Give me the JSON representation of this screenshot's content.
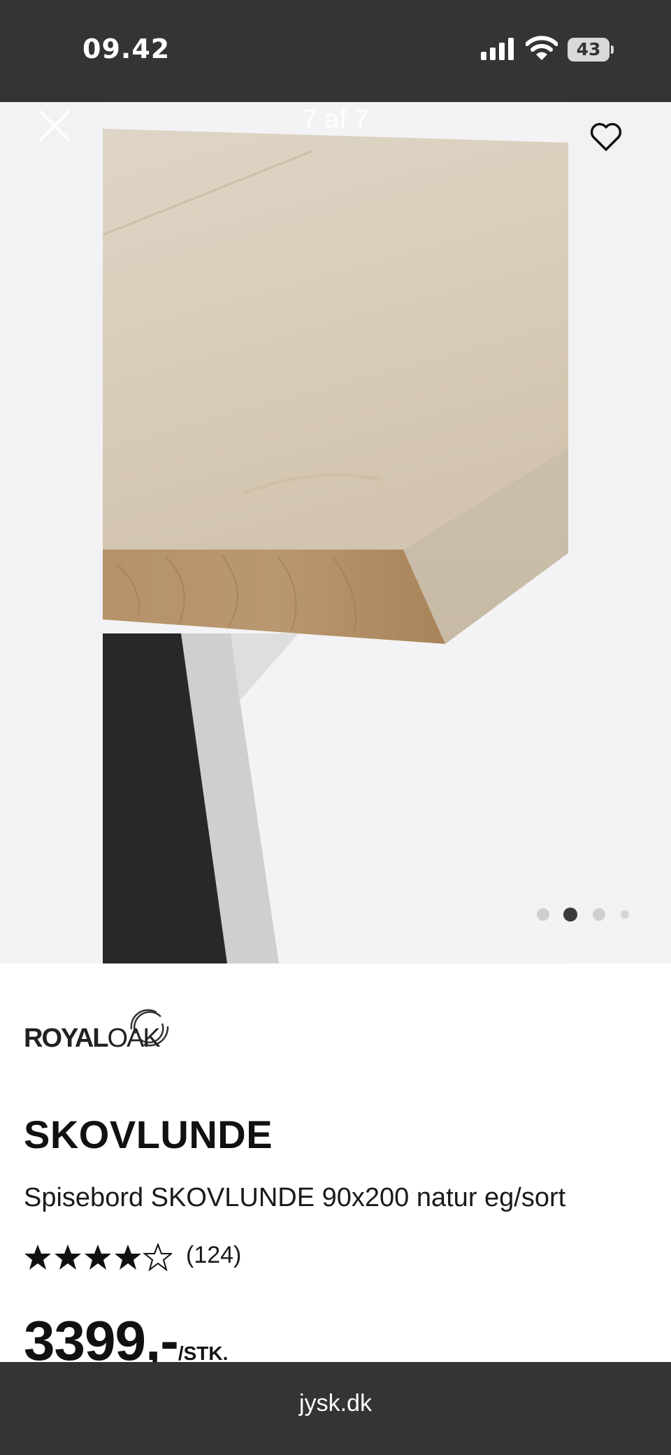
{
  "status_bar": {
    "time": "09.42",
    "battery_percent": "43",
    "icons": [
      "cellular-signal-icon",
      "wifi-icon",
      "battery-icon"
    ]
  },
  "gallery": {
    "counter": "7 af 7",
    "close_icon": "close-icon",
    "favorite_icon": "heart-outline-icon",
    "pagination": {
      "count": 4,
      "active_index": 1
    }
  },
  "product": {
    "brand": {
      "part1": "ROYAL",
      "part2": "OAK"
    },
    "title": "SKOVLUNDE",
    "subtitle": "Spisebord SKOVLUNDE 90x200 natur eg/sort",
    "rating": {
      "stars": 4.5,
      "max": 5,
      "count_label": "(124)"
    },
    "price": {
      "value": "3399,-",
      "unit": "/STK."
    }
  },
  "url_bar": {
    "domain": "jysk.dk"
  },
  "colors": {
    "chrome": "#333436",
    "gallery_bg": "#f2f2f4",
    "dot_active": "#3a3a3a",
    "dot_inactive": "#cfcfcf"
  }
}
